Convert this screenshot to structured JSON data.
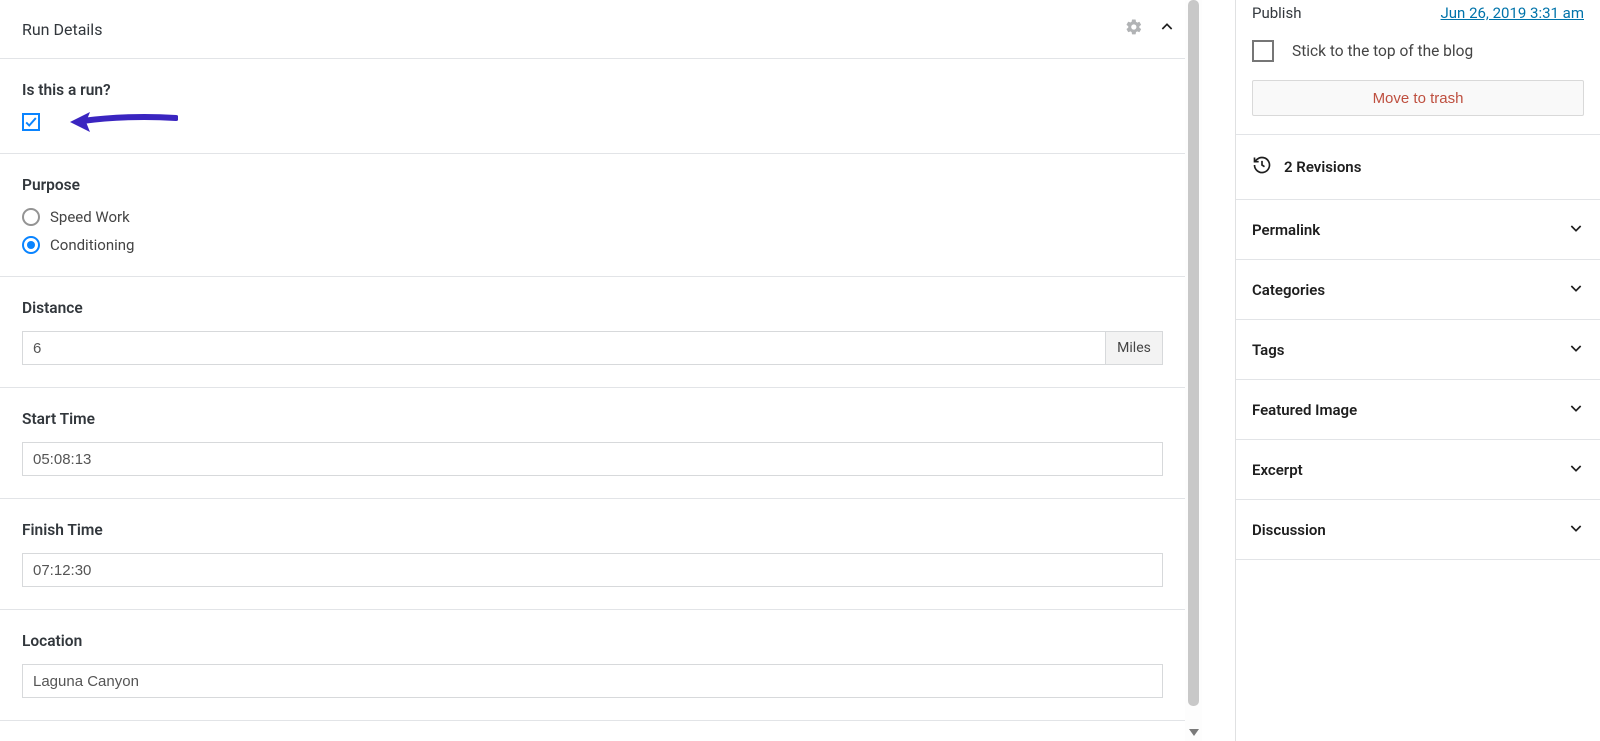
{
  "panel": {
    "title": "Run Details"
  },
  "fields": {
    "isRun": {
      "label": "Is this a run?",
      "checked": true
    },
    "purpose": {
      "label": "Purpose",
      "options": [
        {
          "label": "Speed Work",
          "selected": false
        },
        {
          "label": "Conditioning",
          "selected": true
        }
      ]
    },
    "distance": {
      "label": "Distance",
      "value": "6",
      "unit": "Miles"
    },
    "startTime": {
      "label": "Start Time",
      "value": "05:08:13"
    },
    "finishTime": {
      "label": "Finish Time",
      "value": "07:12:30"
    },
    "location": {
      "label": "Location",
      "value": "Laguna Canyon"
    }
  },
  "sidebar": {
    "publish": {
      "label": "Publish",
      "link": "Jun 26, 2019 3:31 am"
    },
    "stick": {
      "label": "Stick to the top of the blog"
    },
    "trash": {
      "label": "Move to trash"
    },
    "revisions": {
      "count": 2,
      "label": "Revisions",
      "text": "2 Revisions"
    },
    "accordion": [
      "Permalink",
      "Categories",
      "Tags",
      "Featured Image",
      "Excerpt",
      "Discussion"
    ]
  },
  "annotation": {
    "arrowColor": "#3a25c0"
  }
}
